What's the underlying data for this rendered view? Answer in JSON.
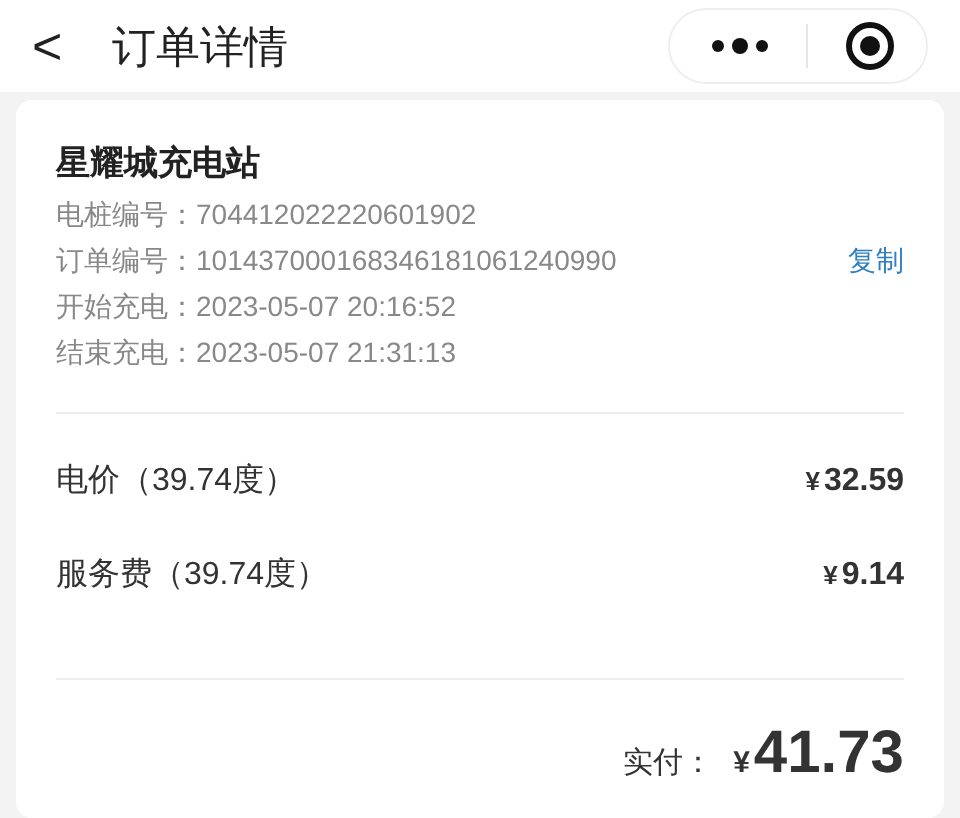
{
  "header": {
    "back": "<",
    "title": "订单详情"
  },
  "station": {
    "name": "星耀城充电站",
    "details": [
      {
        "label": "电桩编号：",
        "value": "704412022220601902"
      },
      {
        "label": "订单编号：",
        "value": "101437000168346181061240990",
        "action": "复制"
      },
      {
        "label": "开始充电：",
        "value": "2023-05-07 20:16:52"
      },
      {
        "label": "结束充电：",
        "value": "2023-05-07 21:31:13"
      }
    ]
  },
  "fees": [
    {
      "label": "电价（39.74度）",
      "currency": "¥",
      "amount": "32.59"
    },
    {
      "label": "服务费（39.74度）",
      "currency": "¥",
      "amount": "9.14"
    }
  ],
  "total": {
    "label": "实付：",
    "currency": "¥",
    "amount": "41.73"
  }
}
